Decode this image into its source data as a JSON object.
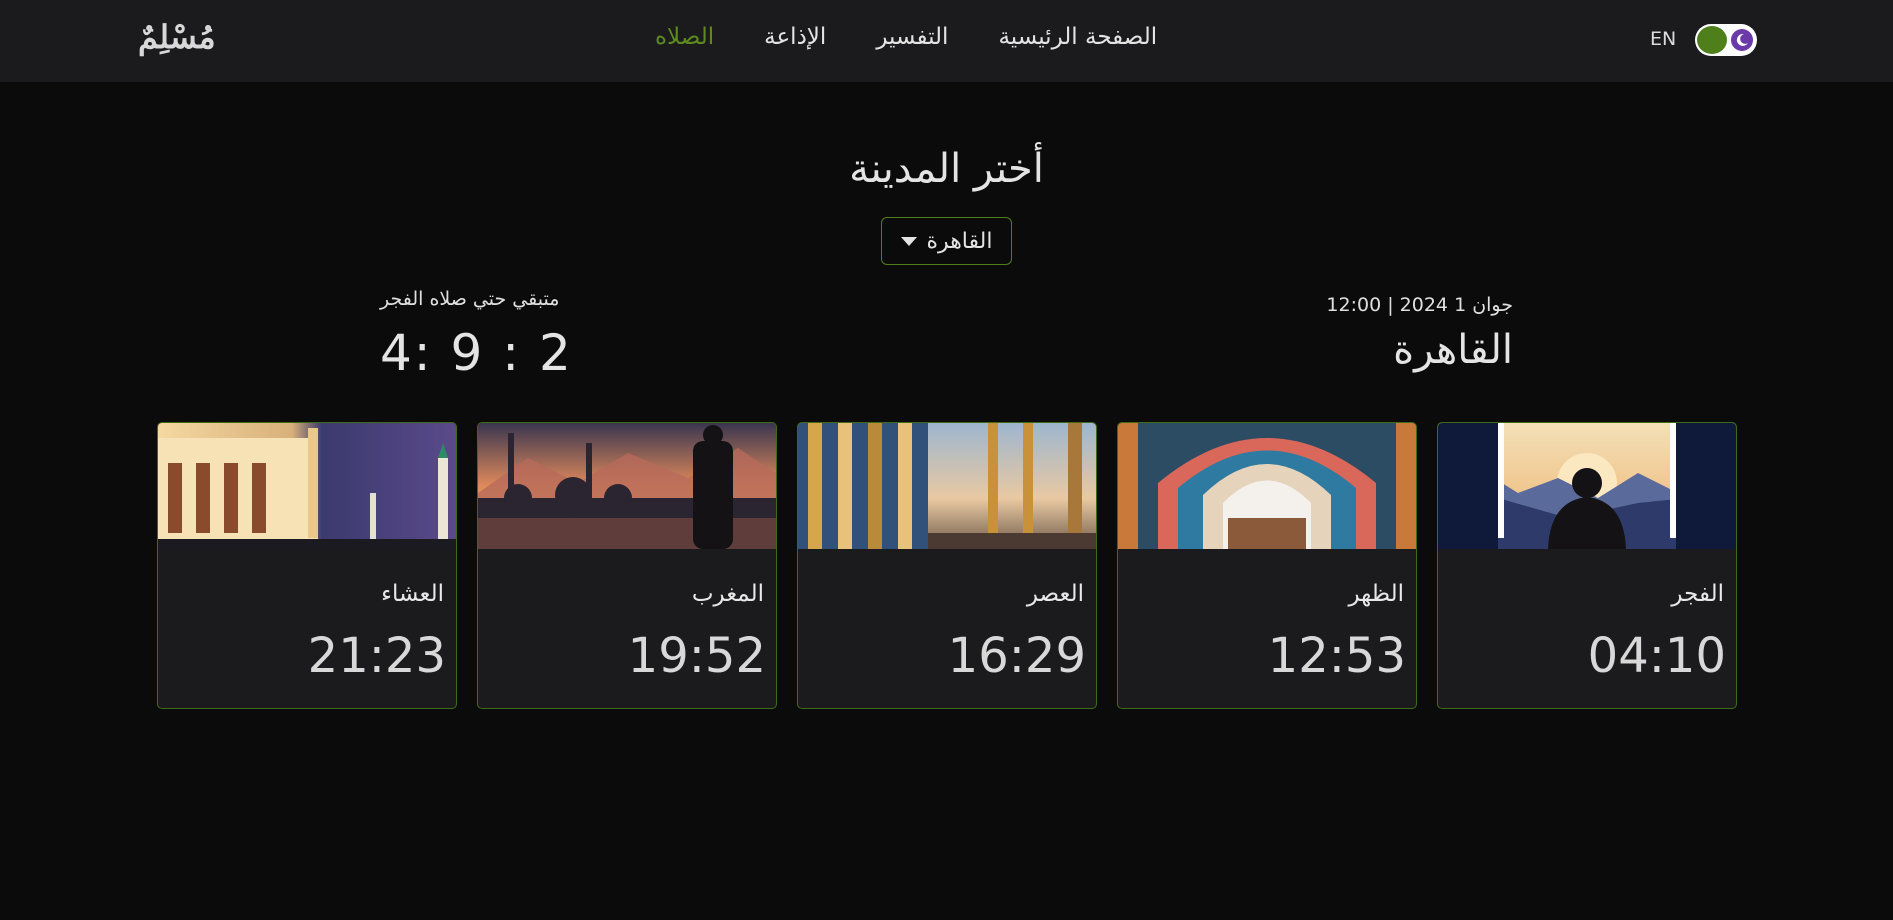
{
  "navbar": {
    "logo": "مُسْلِمٌ",
    "links": [
      {
        "label": "الصلاه",
        "active": true
      },
      {
        "label": "الإذاعة",
        "active": false
      },
      {
        "label": "التفسير",
        "active": false
      },
      {
        "label": "الصفحة الرئيسية",
        "active": false
      }
    ],
    "language": "EN",
    "theme_toggle": {
      "on": true,
      "accent": "#4f7f1b"
    }
  },
  "city_picker": {
    "title": "أختر المدينة",
    "selected": "القاهرة"
  },
  "info": {
    "date_time": "جوان 1 2024 | 12:00",
    "city": "القاهرة",
    "remaining_label": "متبقي حتي صلاه الفجر",
    "countdown": "4: 9 : 2"
  },
  "prayers": [
    {
      "name": "الفجر",
      "time": "04:10",
      "image": "fajr-silhouette-window"
    },
    {
      "name": "الظهر",
      "time": "12:53",
      "image": "dhuhr-mosaic-arch"
    },
    {
      "name": "العصر",
      "time": "16:29",
      "image": "asr-golden-columns"
    },
    {
      "name": "المغرب",
      "time": "19:52",
      "image": "maghrib-sunset-mosque"
    },
    {
      "name": "العشاء",
      "time": "21:23",
      "image": "isha-night-mosque"
    }
  ],
  "colors": {
    "background": "#0b0b0c",
    "navbar": "#1b1b1d",
    "accent": "#5d8a1f",
    "card_border": "#3f6a16"
  }
}
